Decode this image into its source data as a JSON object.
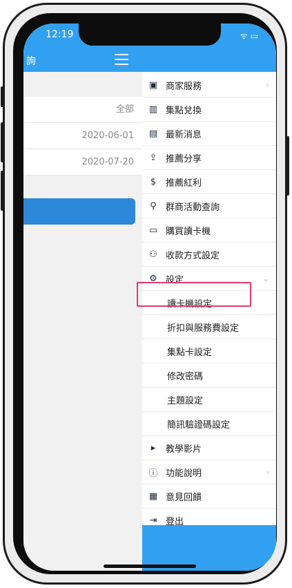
{
  "status_bar": {
    "time": "12:19",
    "icons": "ᯤ ▭"
  },
  "left_panel": {
    "title": "詢",
    "rows": [
      "全部",
      "2020-06-01",
      "2020-07-20"
    ]
  },
  "menu": {
    "items": [
      {
        "label": "商家服務",
        "icon": "store-icon",
        "glyph": "▣",
        "chevron": "›"
      },
      {
        "label": "集點兌換",
        "icon": "stamp-card-icon",
        "glyph": "▥"
      },
      {
        "label": "最新消息",
        "icon": "news-icon",
        "glyph": "▤"
      },
      {
        "label": "推薦分享",
        "icon": "share-icon",
        "glyph": "⇪"
      },
      {
        "label": "推薦紅利",
        "icon": "dollar-icon",
        "glyph": "$"
      },
      {
        "label": "群商活動查詢",
        "icon": "search-icon",
        "glyph": "⚲"
      },
      {
        "label": "購買讀卡機",
        "icon": "card-reader-icon",
        "glyph": "▭"
      },
      {
        "label": "收款方式設定",
        "icon": "payment-icon",
        "glyph": "⚇"
      },
      {
        "label": "設定",
        "icon": "settings-icon",
        "glyph": "⚙",
        "chevron": "⌄"
      },
      {
        "label": "讀卡機設定"
      },
      {
        "label": "折扣與服務費設定",
        "highlighted": true
      },
      {
        "label": "集點卡設定"
      },
      {
        "label": "修改密碼"
      },
      {
        "label": "主題設定"
      },
      {
        "label": "簡訊驗證碼設定"
      },
      {
        "label": "教學影片",
        "icon": "video-icon",
        "glyph": "▸"
      },
      {
        "label": "功能說明",
        "icon": "info-icon",
        "glyph": "ⓘ",
        "chevron": "›"
      },
      {
        "label": "意見回饋",
        "icon": "feedback-icon",
        "glyph": "▦"
      },
      {
        "label": "登出",
        "icon": "logout-icon",
        "glyph": "⇥"
      }
    ]
  },
  "colors": {
    "header_blue": "#32a0f0",
    "highlight": "#e23a6a"
  }
}
